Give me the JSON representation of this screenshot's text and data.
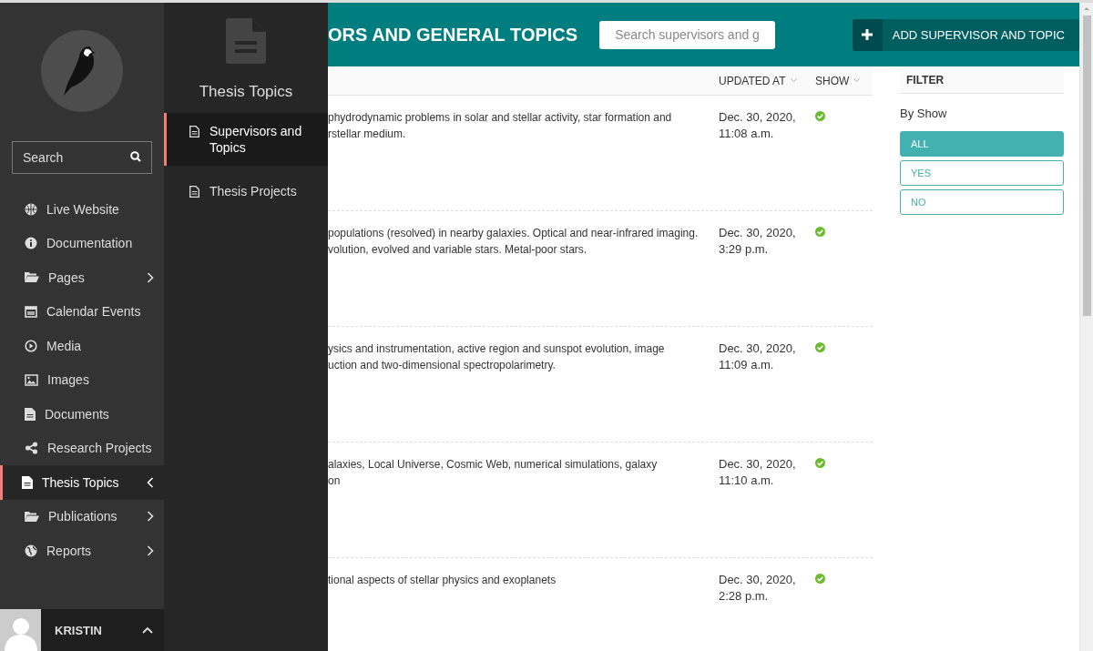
{
  "sidebar": {
    "search": {
      "placeholder": "Search"
    },
    "items": [
      {
        "label": "Live Website",
        "selected": false
      },
      {
        "label": "Documentation",
        "selected": false
      },
      {
        "label": "Pages",
        "selected": false,
        "expanded": false
      },
      {
        "label": "Calendar Events",
        "selected": false
      },
      {
        "label": "Media",
        "selected": false
      },
      {
        "label": "Images",
        "selected": false
      },
      {
        "label": "Documents",
        "selected": false
      },
      {
        "label": "Research Projects",
        "selected": false
      },
      {
        "label": "Thesis Topics",
        "selected": true,
        "expanded": true
      },
      {
        "label": "Publications",
        "selected": false,
        "expanded": false
      },
      {
        "label": "Reports",
        "selected": false,
        "expanded": false
      }
    ],
    "user": {
      "name": "KRISTIN"
    }
  },
  "submenu": {
    "title": "Thesis Topics",
    "items": [
      {
        "label": "Supervisors and Topics",
        "selected": true
      },
      {
        "label": "Thesis Projects",
        "selected": false
      }
    ]
  },
  "header": {
    "title": "ORS AND GENERAL TOPICS",
    "search": {
      "placeholder": "Search supervisors and g"
    },
    "add_button": "ADD SUPERVISOR AND TOPIC"
  },
  "table": {
    "columns": [
      "UPDATED AT",
      "SHOW"
    ],
    "rows": [
      {
        "description": [
          "phydrodynamic problems in solar and stellar activity, star formation and",
          "rstellar medium."
        ],
        "updated_at": [
          "Dec. 30, 2020,",
          "11:08 a.m."
        ],
        "show": true
      },
      {
        "description": [
          "populations (resolved) in nearby galaxies. Optical and near-infrared imaging.",
          "volution, evolved and variable stars. Metal-poor stars."
        ],
        "updated_at": [
          "Dec. 30, 2020,",
          "3:29 p.m."
        ],
        "show": true
      },
      {
        "description": [
          "ysics and instrumentation, active region and sunspot evolution, image",
          "uction and two-dimensional spectropolarimetry."
        ],
        "updated_at": [
          "Dec. 30, 2020,",
          "11:09 a.m."
        ],
        "show": true
      },
      {
        "description": [
          "alaxies, Local Universe, Cosmic Web, numerical simulations, galaxy",
          "on"
        ],
        "updated_at": [
          "Dec. 30, 2020,",
          "11:10 a.m."
        ],
        "show": true
      },
      {
        "description": [
          "tional aspects of stellar physics and exoplanets"
        ],
        "updated_at": [
          "Dec. 30, 2020,",
          "2:28 p.m."
        ],
        "show": true
      }
    ]
  },
  "filter": {
    "title": "FILTER",
    "label": "By Show",
    "options": [
      {
        "label": "ALL",
        "selected": true
      },
      {
        "label": "YES",
        "selected": false
      },
      {
        "label": "NO",
        "selected": false
      }
    ]
  }
}
